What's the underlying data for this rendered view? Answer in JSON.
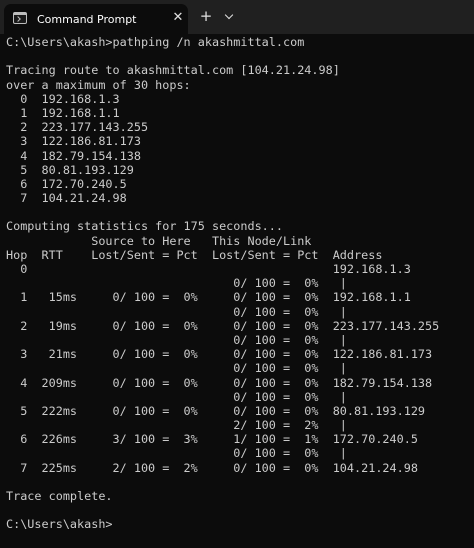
{
  "window": {
    "tab_title": "Command Prompt",
    "tab_icon": "command-prompt-icon",
    "close_glyph": "✕",
    "new_tab_glyph": "+"
  },
  "colors": {
    "background": "#0c0c0c",
    "foreground": "#cccccc",
    "tabbar": "#202020"
  },
  "terminal": {
    "lines": [
      "C:\\Users\\akash>pathping /n akashmittal.com",
      "",
      "Tracing route to akashmittal.com [104.21.24.98]",
      "over a maximum of 30 hops:",
      "  0  192.168.1.3",
      "  1  192.168.1.1",
      "  2  223.177.143.255",
      "  3  122.186.81.173",
      "  4  182.79.154.138",
      "  5  80.81.193.129",
      "  6  172.70.240.5",
      "  7  104.21.24.98",
      "",
      "Computing statistics for 175 seconds...",
      "            Source to Here   This Node/Link",
      "Hop  RTT    Lost/Sent = Pct  Lost/Sent = Pct  Address",
      "  0                                           192.168.1.3",
      "                                0/ 100 =  0%   |",
      "  1   15ms     0/ 100 =  0%     0/ 100 =  0%  192.168.1.1",
      "                                0/ 100 =  0%   |",
      "  2   19ms     0/ 100 =  0%     0/ 100 =  0%  223.177.143.255",
      "                                0/ 100 =  0%   |",
      "  3   21ms     0/ 100 =  0%     0/ 100 =  0%  122.186.81.173",
      "                                0/ 100 =  0%   |",
      "  4  209ms     0/ 100 =  0%     0/ 100 =  0%  182.79.154.138",
      "                                0/ 100 =  0%   |",
      "  5  222ms     0/ 100 =  0%     0/ 100 =  0%  80.81.193.129",
      "                                2/ 100 =  2%   |",
      "  6  226ms     3/ 100 =  3%     1/ 100 =  1%  172.70.240.5",
      "                                0/ 100 =  0%   |",
      "  7  225ms     2/ 100 =  2%     0/ 100 =  0%  104.21.24.98",
      "",
      "Trace complete.",
      "",
      "C:\\Users\\akash>"
    ]
  }
}
